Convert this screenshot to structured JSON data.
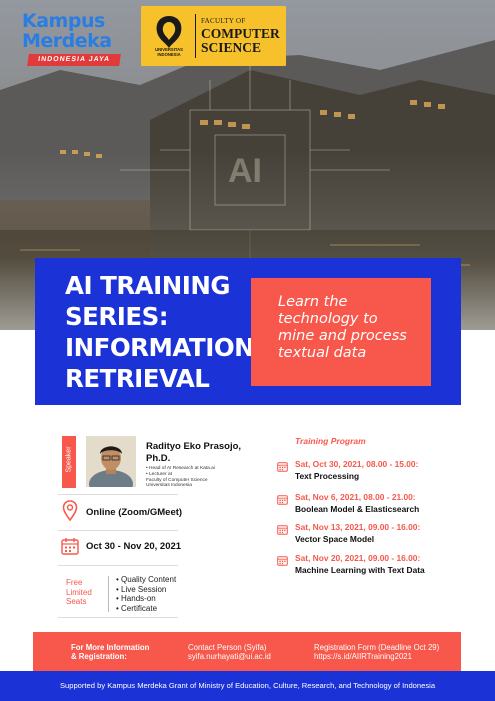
{
  "logos": {
    "kampus_merdeka": {
      "line1": "Kampus",
      "line2": "Merdeka",
      "ribbon": "INDONESIA JAYA"
    },
    "faculty": {
      "small": "FACULTY OF",
      "big1": "COMPUTER",
      "big2": "SCIENCE",
      "uni1": "UNIVERSITAS",
      "uni2": "INDONESIA"
    }
  },
  "banner": {
    "title_lines": [
      "AI TRAINING",
      "SERIES:",
      "INFORMATION",
      "RETRIEVAL"
    ],
    "tagline_lines": [
      "Learn the",
      "technology to",
      "mine and process",
      "textual data"
    ]
  },
  "speaker": {
    "tab_label": "Speaker",
    "name_line1": "Radityo Eko Prasojo,",
    "name_line2": "Ph.D.",
    "bio_lines": [
      "• Head of AI Research at Kata.ai",
      "• Lecturer at",
      "Faculty of Computer Science",
      "Universitas Indonesia"
    ]
  },
  "location": {
    "text": "Online (Zoom/GMeet)"
  },
  "dates": {
    "text": "Oct 30 - Nov 20, 2021"
  },
  "seats": {
    "label_lines": [
      "Free",
      "Limited",
      "Seats"
    ],
    "bullets": [
      "• Quality Content",
      "• Live Session",
      "• Hands-on",
      "• Certificate"
    ]
  },
  "program": {
    "title": "Training Program",
    "items": [
      {
        "date": "Sat, Oct 30, 2021, 08.00 - 15.00:",
        "topic": "Text Processing"
      },
      {
        "date": "Sat, Nov 6, 2021, 08.00 - 21.00:",
        "topic": "Boolean Model & Elasticsearch"
      },
      {
        "date": "Sat, Nov 13, 2021, 09.00 - 16.00:",
        "topic": "Vector Space Model"
      },
      {
        "date": "Sat, Nov 20, 2021, 09.00 - 16.00:",
        "topic": "Machine Learning with Text Data"
      }
    ]
  },
  "footer": {
    "more_info_line1": "For More Information",
    "more_info_line2": "& Registration:",
    "contact_line1": "Contact Person (Syifa)",
    "contact_line2": "syifa.nurhayati@ui.ac.id",
    "register_line1": "Registration Form (Deadline Oct 29)",
    "register_line2": "https://s.id/AIIRTraining2021",
    "support": "Supported by Kampus Merdeka Grant of Ministry of Education, Culture, Research, and Technology of Indonesia"
  },
  "colors": {
    "blue": "#1b33d6",
    "coral": "#f7584b",
    "gold": "#f6c12a"
  }
}
